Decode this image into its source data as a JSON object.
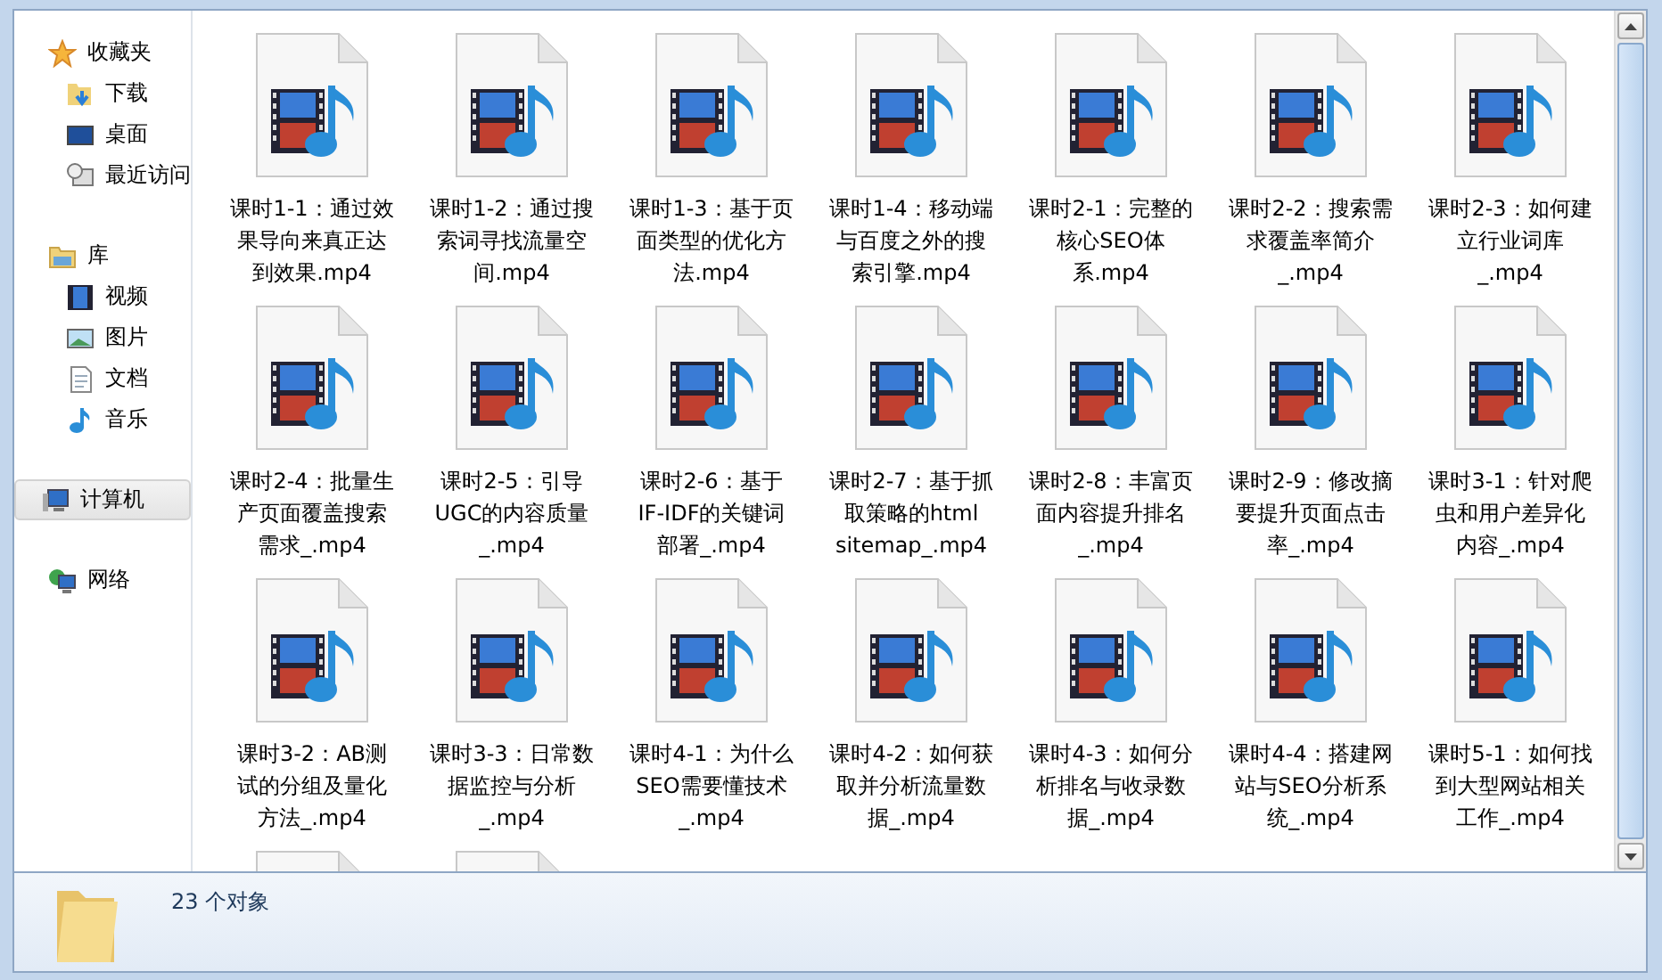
{
  "sidebar": {
    "groups": [
      {
        "label": "收藏夹",
        "kind": "favorites",
        "selected": false,
        "children": [
          {
            "label": "下载",
            "kind": "download",
            "selected": false
          },
          {
            "label": "桌面",
            "kind": "desktop",
            "selected": false
          },
          {
            "label": "最近访问",
            "kind": "recent",
            "selected": false
          }
        ]
      },
      {
        "label": "库",
        "kind": "library",
        "selected": false,
        "children": [
          {
            "label": "视频",
            "kind": "video",
            "selected": false
          },
          {
            "label": "图片",
            "kind": "picture",
            "selected": false
          },
          {
            "label": "文档",
            "kind": "document",
            "selected": false
          },
          {
            "label": "音乐",
            "kind": "music",
            "selected": false
          }
        ]
      },
      {
        "label": "计算机",
        "kind": "computer",
        "selected": true
      },
      {
        "label": "网络",
        "kind": "network",
        "selected": false
      }
    ]
  },
  "files": [
    {
      "name": "课时1-1：通过效果导向来真正达到效果.mp4"
    },
    {
      "name": "课时1-2：通过搜索词寻找流量空间.mp4"
    },
    {
      "name": "课时1-3：基于页面类型的优化方法.mp4"
    },
    {
      "name": "课时1-4：移动端与百度之外的搜索引擎.mp4"
    },
    {
      "name": "课时2-1：完整的核心SEO体系.mp4"
    },
    {
      "name": "课时2-2：搜索需求覆盖率简介_.mp4"
    },
    {
      "name": "课时2-3：如何建立行业词库_.mp4"
    },
    {
      "name": "课时2-4：批量生产页面覆盖搜索需求_.mp4"
    },
    {
      "name": "课时2-5：引导UGC的内容质量_.mp4"
    },
    {
      "name": "课时2-6：基于IF-IDF的关键词部署_.mp4"
    },
    {
      "name": "课时2-7：基于抓取策略的html sitemap_.mp4"
    },
    {
      "name": "课时2-8：丰富页面内容提升排名_.mp4"
    },
    {
      "name": "课时2-9：修改摘要提升页面点击率_.mp4"
    },
    {
      "name": "课时3-1：针对爬虫和用户差异化内容_.mp4"
    },
    {
      "name": "课时3-2：AB测试的分组及量化方法_.mp4"
    },
    {
      "name": "课时3-3：日常数据监控与分析_.mp4"
    },
    {
      "name": "课时4-1：为什么SEO需要懂技术_.mp4"
    },
    {
      "name": "课时4-2：如何获取并分析流量数据_.mp4"
    },
    {
      "name": "课时4-3：如何分析排名与收录数据_.mp4"
    },
    {
      "name": "课时4-4：搭建网站与SEO分析系统_.mp4"
    },
    {
      "name": "课时5-1：如何找到大型网站相关工作_.mp4"
    }
  ],
  "cut_off_tiles": [
    {
      "kind": "video"
    },
    {
      "kind": "video"
    }
  ],
  "status_bar": {
    "count": "23 个对象"
  }
}
